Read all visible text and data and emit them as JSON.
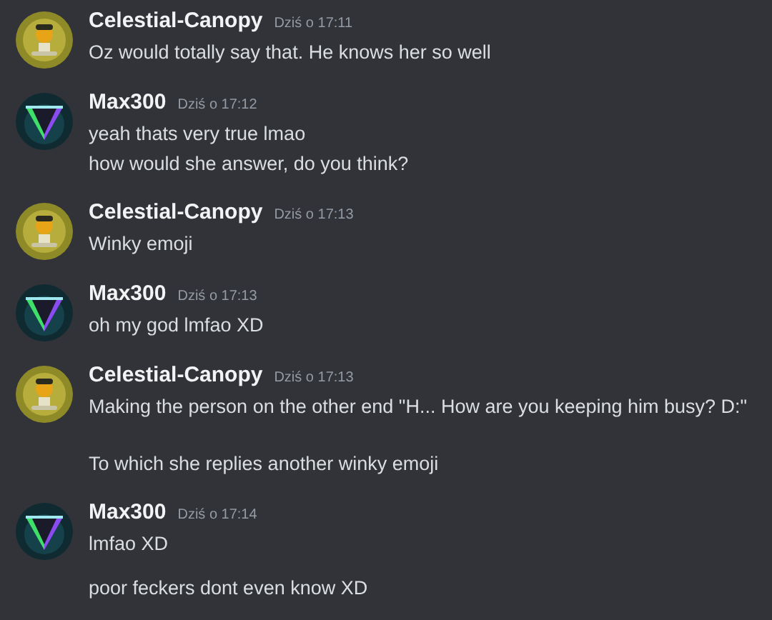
{
  "messages": [
    {
      "author": "Celestial-Canopy",
      "kind": "canopy",
      "time": "Dziś o 17:11",
      "lines": [
        {
          "kind": "line",
          "text": "Oz would totally say that. He knows her so well"
        }
      ]
    },
    {
      "author": "Max300",
      "kind": "triangle",
      "time": "Dziś o 17:12",
      "lines": [
        {
          "kind": "line",
          "text": "yeah thats very true lmao"
        },
        {
          "kind": "line",
          "text": "how would she answer, do you think?"
        }
      ]
    },
    {
      "author": "Celestial-Canopy",
      "kind": "canopy",
      "time": "Dziś o 17:13",
      "lines": [
        {
          "kind": "line",
          "text": "Winky emoji"
        }
      ]
    },
    {
      "author": "Max300",
      "kind": "triangle",
      "time": "Dziś o 17:13",
      "lines": [
        {
          "kind": "line",
          "text": "oh my god lmfao XD"
        }
      ]
    },
    {
      "author": "Celestial-Canopy",
      "kind": "canopy",
      "time": "Dziś o 17:13",
      "lines": [
        {
          "kind": "line",
          "text": "Making the person on the other end \"H... How are you keeping him busy? D:\""
        },
        {
          "kind": "paragraph",
          "text": "To which she replies another winky emoji"
        }
      ]
    },
    {
      "author": "Max300",
      "kind": "triangle",
      "time": "Dziś o 17:14",
      "lines": [
        {
          "kind": "line",
          "text": "lmfao XD"
        },
        {
          "kind": "message",
          "text": "poor feckers dont even know XD"
        }
      ]
    }
  ]
}
